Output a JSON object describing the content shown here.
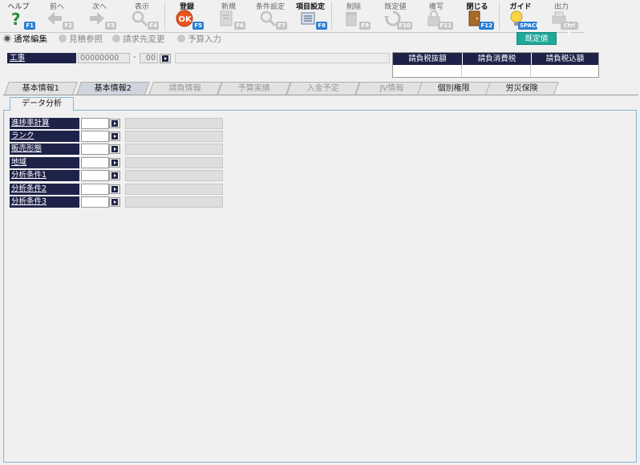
{
  "toolbar": {
    "help": {
      "label": "ヘルプ",
      "key": "F1"
    },
    "prev": {
      "label": "前へ",
      "key": "F2"
    },
    "next": {
      "label": "次へ",
      "key": "F3"
    },
    "display": {
      "label": "表示",
      "key": "F4"
    },
    "register": {
      "label": "登録",
      "key": "F5"
    },
    "new": {
      "label": "新規",
      "key": "F6"
    },
    "condition": {
      "label": "条件設定",
      "key": "F7"
    },
    "item_setting": {
      "label": "項目設定",
      "key": "F8"
    },
    "delete": {
      "label": "削除",
      "key": "F9"
    },
    "default": {
      "label": "既定値",
      "key": "F10"
    },
    "copy": {
      "label": "複写",
      "key": "F11"
    },
    "close": {
      "label": "閉じる",
      "key": "F12"
    },
    "guide": {
      "label": "ガイド",
      "key": "SPACE"
    },
    "output": {
      "label": "出力",
      "key": "Ctrl P"
    }
  },
  "modes": {
    "normal_edit": "通常編集",
    "estimate_ref": "見積参照",
    "billing_change": "請求先変更",
    "budget_input": "予算入力",
    "default_value_btn": "既定値"
  },
  "header": {
    "label": "工事",
    "code": "00000000",
    "dash": "-",
    "sub_code": "00",
    "name": ""
  },
  "summary": {
    "col1": "請負税抜額",
    "col2": "請負消費税",
    "col3": "請負税込額"
  },
  "tabs": [
    "基本情報1",
    "基本情報2",
    "請負情報",
    "予算実績",
    "入金予定",
    "JV情報",
    "個別権限",
    "労災保険"
  ],
  "subtab": "データ分析",
  "fields": [
    "進捗率計算",
    "ランク",
    "販売形態",
    "地域",
    "分析条件1",
    "分析条件2",
    "分析条件3"
  ],
  "colors": {
    "navy": "#1f2248",
    "accent": "#20a89a",
    "panel_border": "#7fb6dc"
  }
}
